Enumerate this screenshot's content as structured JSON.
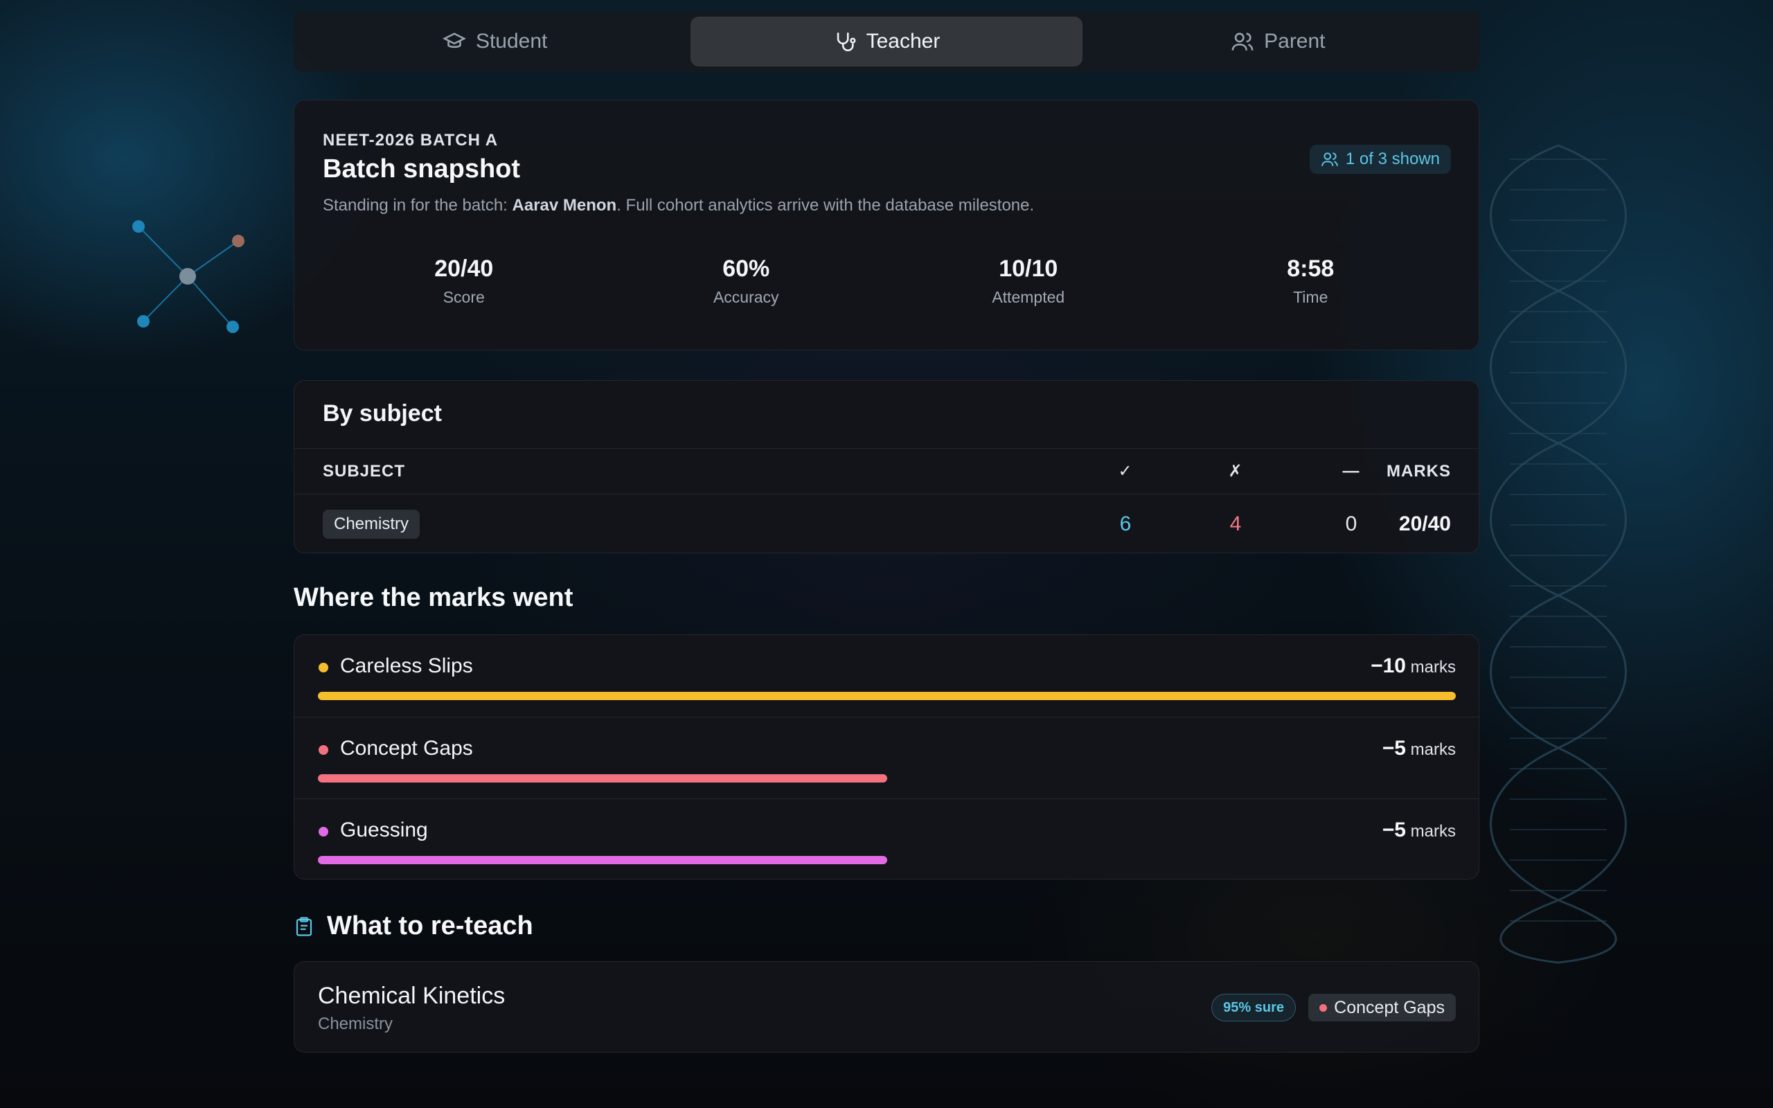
{
  "roles": [
    {
      "label": "Student",
      "icon": "graduation-cap-icon",
      "active": false
    },
    {
      "label": "Teacher",
      "icon": "stethoscope-icon",
      "active": true
    },
    {
      "label": "Parent",
      "icon": "users-icon",
      "active": false
    }
  ],
  "snapshot": {
    "eyebrow": "NEET-2026 BATCH A",
    "title": "Batch snapshot",
    "sub_prefix": "Standing in for the batch: ",
    "student_name": "Aarav Menon",
    "sub_suffix": ". Full cohort analytics arrive with the database milestone.",
    "shown_badge": "1 of 3 shown",
    "stats": [
      {
        "value": "20/40",
        "label": "Score"
      },
      {
        "value": "60%",
        "label": "Accuracy"
      },
      {
        "value": "10/10",
        "label": "Attempted"
      },
      {
        "value": "8:58",
        "label": "Time"
      }
    ]
  },
  "by_subject": {
    "heading": "By subject",
    "columns": {
      "subject": "SUBJECT",
      "correct": "✓",
      "wrong": "✗",
      "skipped": "—",
      "marks": "MARKS"
    },
    "rows": [
      {
        "subject": "Chemistry",
        "correct": "6",
        "wrong": "4",
        "skipped": "0",
        "marks": "20/40"
      }
    ]
  },
  "marks_lost": {
    "heading": "Where the marks went",
    "unit": "marks",
    "items": [
      {
        "label": "Careless Slips",
        "value": "−10",
        "fraction": 1.0,
        "color": "#f6be2c"
      },
      {
        "label": "Concept Gaps",
        "value": "−5",
        "fraction": 0.5,
        "color": "#f4727f"
      },
      {
        "label": "Guessing",
        "value": "−5",
        "fraction": 0.5,
        "color": "#e36ae6"
      }
    ]
  },
  "reteach": {
    "heading": "What to re-teach",
    "items": [
      {
        "topic": "Chemical Kinetics",
        "subject": "Chemistry",
        "confidence": "95% sure",
        "tag": "Concept Gaps",
        "tag_color": "#f4727f"
      }
    ]
  },
  "colors": {
    "accent": "#5cc6e6",
    "wrong": "#f07a86"
  }
}
